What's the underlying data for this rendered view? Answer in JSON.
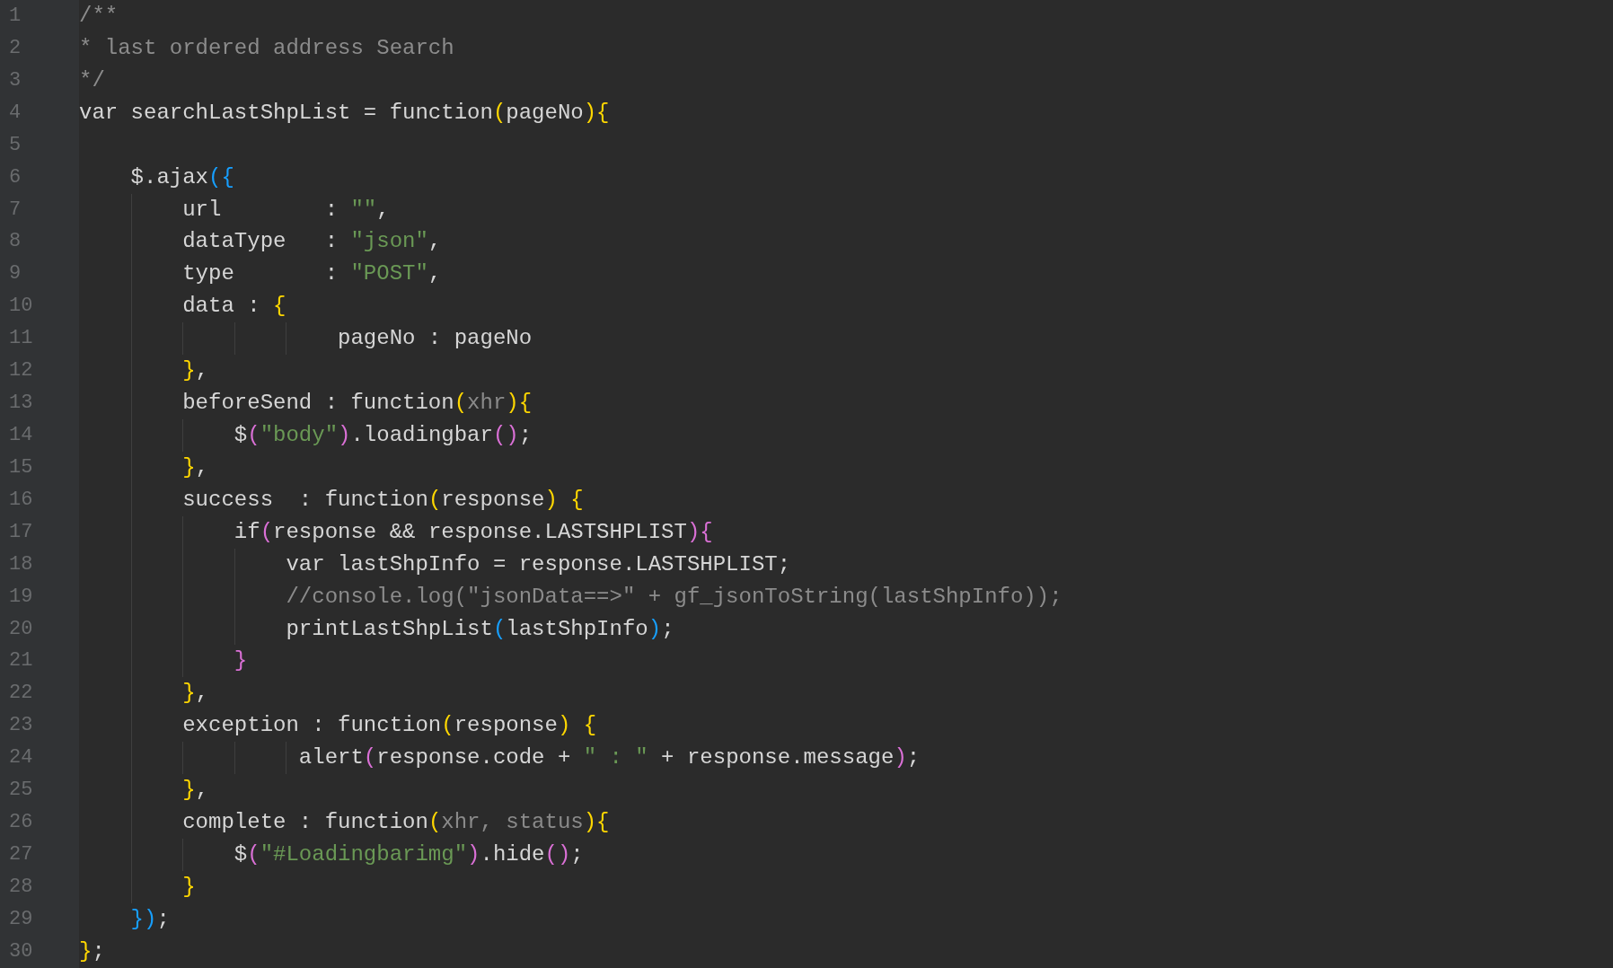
{
  "editor": {
    "lines": [
      {
        "number": "1",
        "tokens": [
          {
            "kind": "comment",
            "text": "/**"
          }
        ]
      },
      {
        "number": "2",
        "tokens": [
          {
            "kind": "comment",
            "text": "* last ordered address Search"
          }
        ]
      },
      {
        "number": "3",
        "tokens": [
          {
            "kind": "comment",
            "text": "*/"
          }
        ]
      },
      {
        "number": "4",
        "tokens": [
          {
            "kind": "plain",
            "text": "var searchLastShpList = function"
          },
          {
            "kind": "bracket",
            "color": "#ffd700",
            "text": "("
          },
          {
            "kind": "plain",
            "text": "pageNo"
          },
          {
            "kind": "bracket",
            "color": "#ffd700",
            "text": "){"
          }
        ]
      },
      {
        "number": "5"
      },
      {
        "number": "6",
        "tokens": [
          {
            "kind": "plain",
            "text": "    $.ajax"
          },
          {
            "kind": "bracket",
            "color": "#179fff",
            "text": "({"
          }
        ]
      },
      {
        "number": "7",
        "tokens": [
          {
            "kind": "plain",
            "text": "        url        : "
          },
          {
            "kind": "string",
            "text": "\"\""
          },
          {
            "kind": "plain",
            "text": ","
          }
        ]
      },
      {
        "number": "8",
        "tokens": [
          {
            "kind": "plain",
            "text": "        dataType   : "
          },
          {
            "kind": "string",
            "text": "\"json\""
          },
          {
            "kind": "plain",
            "text": ","
          }
        ]
      },
      {
        "number": "9",
        "tokens": [
          {
            "kind": "plain",
            "text": "        type       : "
          },
          {
            "kind": "string",
            "text": "\"POST\""
          },
          {
            "kind": "plain",
            "text": ","
          }
        ]
      },
      {
        "number": "10",
        "tokens": [
          {
            "kind": "plain",
            "text": "        data : "
          },
          {
            "kind": "bracket",
            "color": "#ffd700",
            "text": "{"
          }
        ]
      },
      {
        "number": "11",
        "tokens": [
          {
            "kind": "plain",
            "text": "                    pageNo : pageNo"
          }
        ]
      },
      {
        "number": "12",
        "tokens": [
          {
            "kind": "bracket",
            "color": "#ffd700",
            "text": "        }"
          },
          {
            "kind": "plain",
            "text": ","
          }
        ]
      },
      {
        "number": "13",
        "tokens": [
          {
            "kind": "plain",
            "text": "        beforeSend : function"
          },
          {
            "kind": "bracket",
            "color": "#ffd700",
            "text": "("
          },
          {
            "kind": "param",
            "text": "xhr"
          },
          {
            "kind": "bracket",
            "color": "#ffd700",
            "text": "){"
          }
        ]
      },
      {
        "number": "14",
        "tokens": [
          {
            "kind": "plain",
            "text": "            $"
          },
          {
            "kind": "bracket",
            "color": "#da70d6",
            "text": "("
          },
          {
            "kind": "string",
            "text": "\"body\""
          },
          {
            "kind": "bracket",
            "color": "#da70d6",
            "text": ")"
          },
          {
            "kind": "plain",
            "text": ".loadingbar"
          },
          {
            "kind": "bracket",
            "color": "#da70d6",
            "text": "()"
          },
          {
            "kind": "plain",
            "text": ";"
          }
        ]
      },
      {
        "number": "15",
        "tokens": [
          {
            "kind": "bracket",
            "color": "#ffd700",
            "text": "        }"
          },
          {
            "kind": "plain",
            "text": ","
          }
        ]
      },
      {
        "number": "16",
        "tokens": [
          {
            "kind": "plain",
            "text": "        success  : function"
          },
          {
            "kind": "bracket",
            "color": "#ffd700",
            "text": "("
          },
          {
            "kind": "plain",
            "text": "response"
          },
          {
            "kind": "bracket",
            "color": "#ffd700",
            "text": ") {"
          }
        ]
      },
      {
        "number": "17",
        "tokens": [
          {
            "kind": "plain",
            "text": "            if"
          },
          {
            "kind": "bracket",
            "color": "#da70d6",
            "text": "("
          },
          {
            "kind": "plain",
            "text": "response && response.LASTSHPLIST"
          },
          {
            "kind": "bracket",
            "color": "#da70d6",
            "text": "){"
          }
        ]
      },
      {
        "number": "18",
        "tokens": [
          {
            "kind": "plain",
            "text": "                var lastShpInfo = response.LASTSHPLIST;"
          }
        ]
      },
      {
        "number": "19",
        "tokens": [
          {
            "kind": "comment",
            "text": "                //console.log(\"jsonData==>\" + gf_jsonToString(lastShpInfo));"
          }
        ]
      },
      {
        "number": "20",
        "tokens": [
          {
            "kind": "plain",
            "text": "                printLastShpList"
          },
          {
            "kind": "bracket",
            "color": "#179fff",
            "text": "("
          },
          {
            "kind": "plain",
            "text": "lastShpInfo"
          },
          {
            "kind": "bracket",
            "color": "#179fff",
            "text": ")"
          },
          {
            "kind": "plain",
            "text": ";"
          }
        ]
      },
      {
        "number": "21",
        "tokens": [
          {
            "kind": "bracket",
            "color": "#da70d6",
            "text": "            }"
          }
        ]
      },
      {
        "number": "22",
        "tokens": [
          {
            "kind": "bracket",
            "color": "#ffd700",
            "text": "        }"
          },
          {
            "kind": "plain",
            "text": ","
          }
        ]
      },
      {
        "number": "23",
        "tokens": [
          {
            "kind": "plain",
            "text": "        exception : function"
          },
          {
            "kind": "bracket",
            "color": "#ffd700",
            "text": "("
          },
          {
            "kind": "plain",
            "text": "response"
          },
          {
            "kind": "bracket",
            "color": "#ffd700",
            "text": ") {"
          }
        ]
      },
      {
        "number": "24",
        "tokens": [
          {
            "kind": "plain",
            "text": "                 alert"
          },
          {
            "kind": "bracket",
            "color": "#da70d6",
            "text": "("
          },
          {
            "kind": "plain",
            "text": "response.code + "
          },
          {
            "kind": "string",
            "text": "\" : \""
          },
          {
            "kind": "plain",
            "text": " + response.message"
          },
          {
            "kind": "bracket",
            "color": "#da70d6",
            "text": ")"
          },
          {
            "kind": "plain",
            "text": ";"
          }
        ]
      },
      {
        "number": "25",
        "tokens": [
          {
            "kind": "bracket",
            "color": "#ffd700",
            "text": "        }"
          },
          {
            "kind": "plain",
            "text": ","
          }
        ]
      },
      {
        "number": "26",
        "tokens": [
          {
            "kind": "plain",
            "text": "        complete : function"
          },
          {
            "kind": "bracket",
            "color": "#ffd700",
            "text": "("
          },
          {
            "kind": "param",
            "text": "xhr, status"
          },
          {
            "kind": "bracket",
            "color": "#ffd700",
            "text": "){"
          }
        ]
      },
      {
        "number": "27",
        "tokens": [
          {
            "kind": "plain",
            "text": "            $"
          },
          {
            "kind": "bracket",
            "color": "#da70d6",
            "text": "("
          },
          {
            "kind": "string",
            "text": "\"#Loadingbarimg\""
          },
          {
            "kind": "bracket",
            "color": "#da70d6",
            "text": ")"
          },
          {
            "kind": "plain",
            "text": ".hide"
          },
          {
            "kind": "bracket",
            "color": "#da70d6",
            "text": "()"
          },
          {
            "kind": "plain",
            "text": ";"
          }
        ]
      },
      {
        "number": "28",
        "tokens": [
          {
            "kind": "bracket",
            "color": "#ffd700",
            "text": "        }"
          }
        ]
      },
      {
        "number": "29",
        "tokens": [
          {
            "kind": "bracket",
            "color": "#179fff",
            "text": "    })"
          },
          {
            "kind": "plain",
            "text": ";"
          }
        ]
      },
      {
        "number": "30",
        "tokens": [
          {
            "kind": "bracket",
            "color": "#ffd700",
            "text": "}"
          },
          {
            "kind": "plain",
            "text": ";"
          }
        ]
      }
    ]
  }
}
